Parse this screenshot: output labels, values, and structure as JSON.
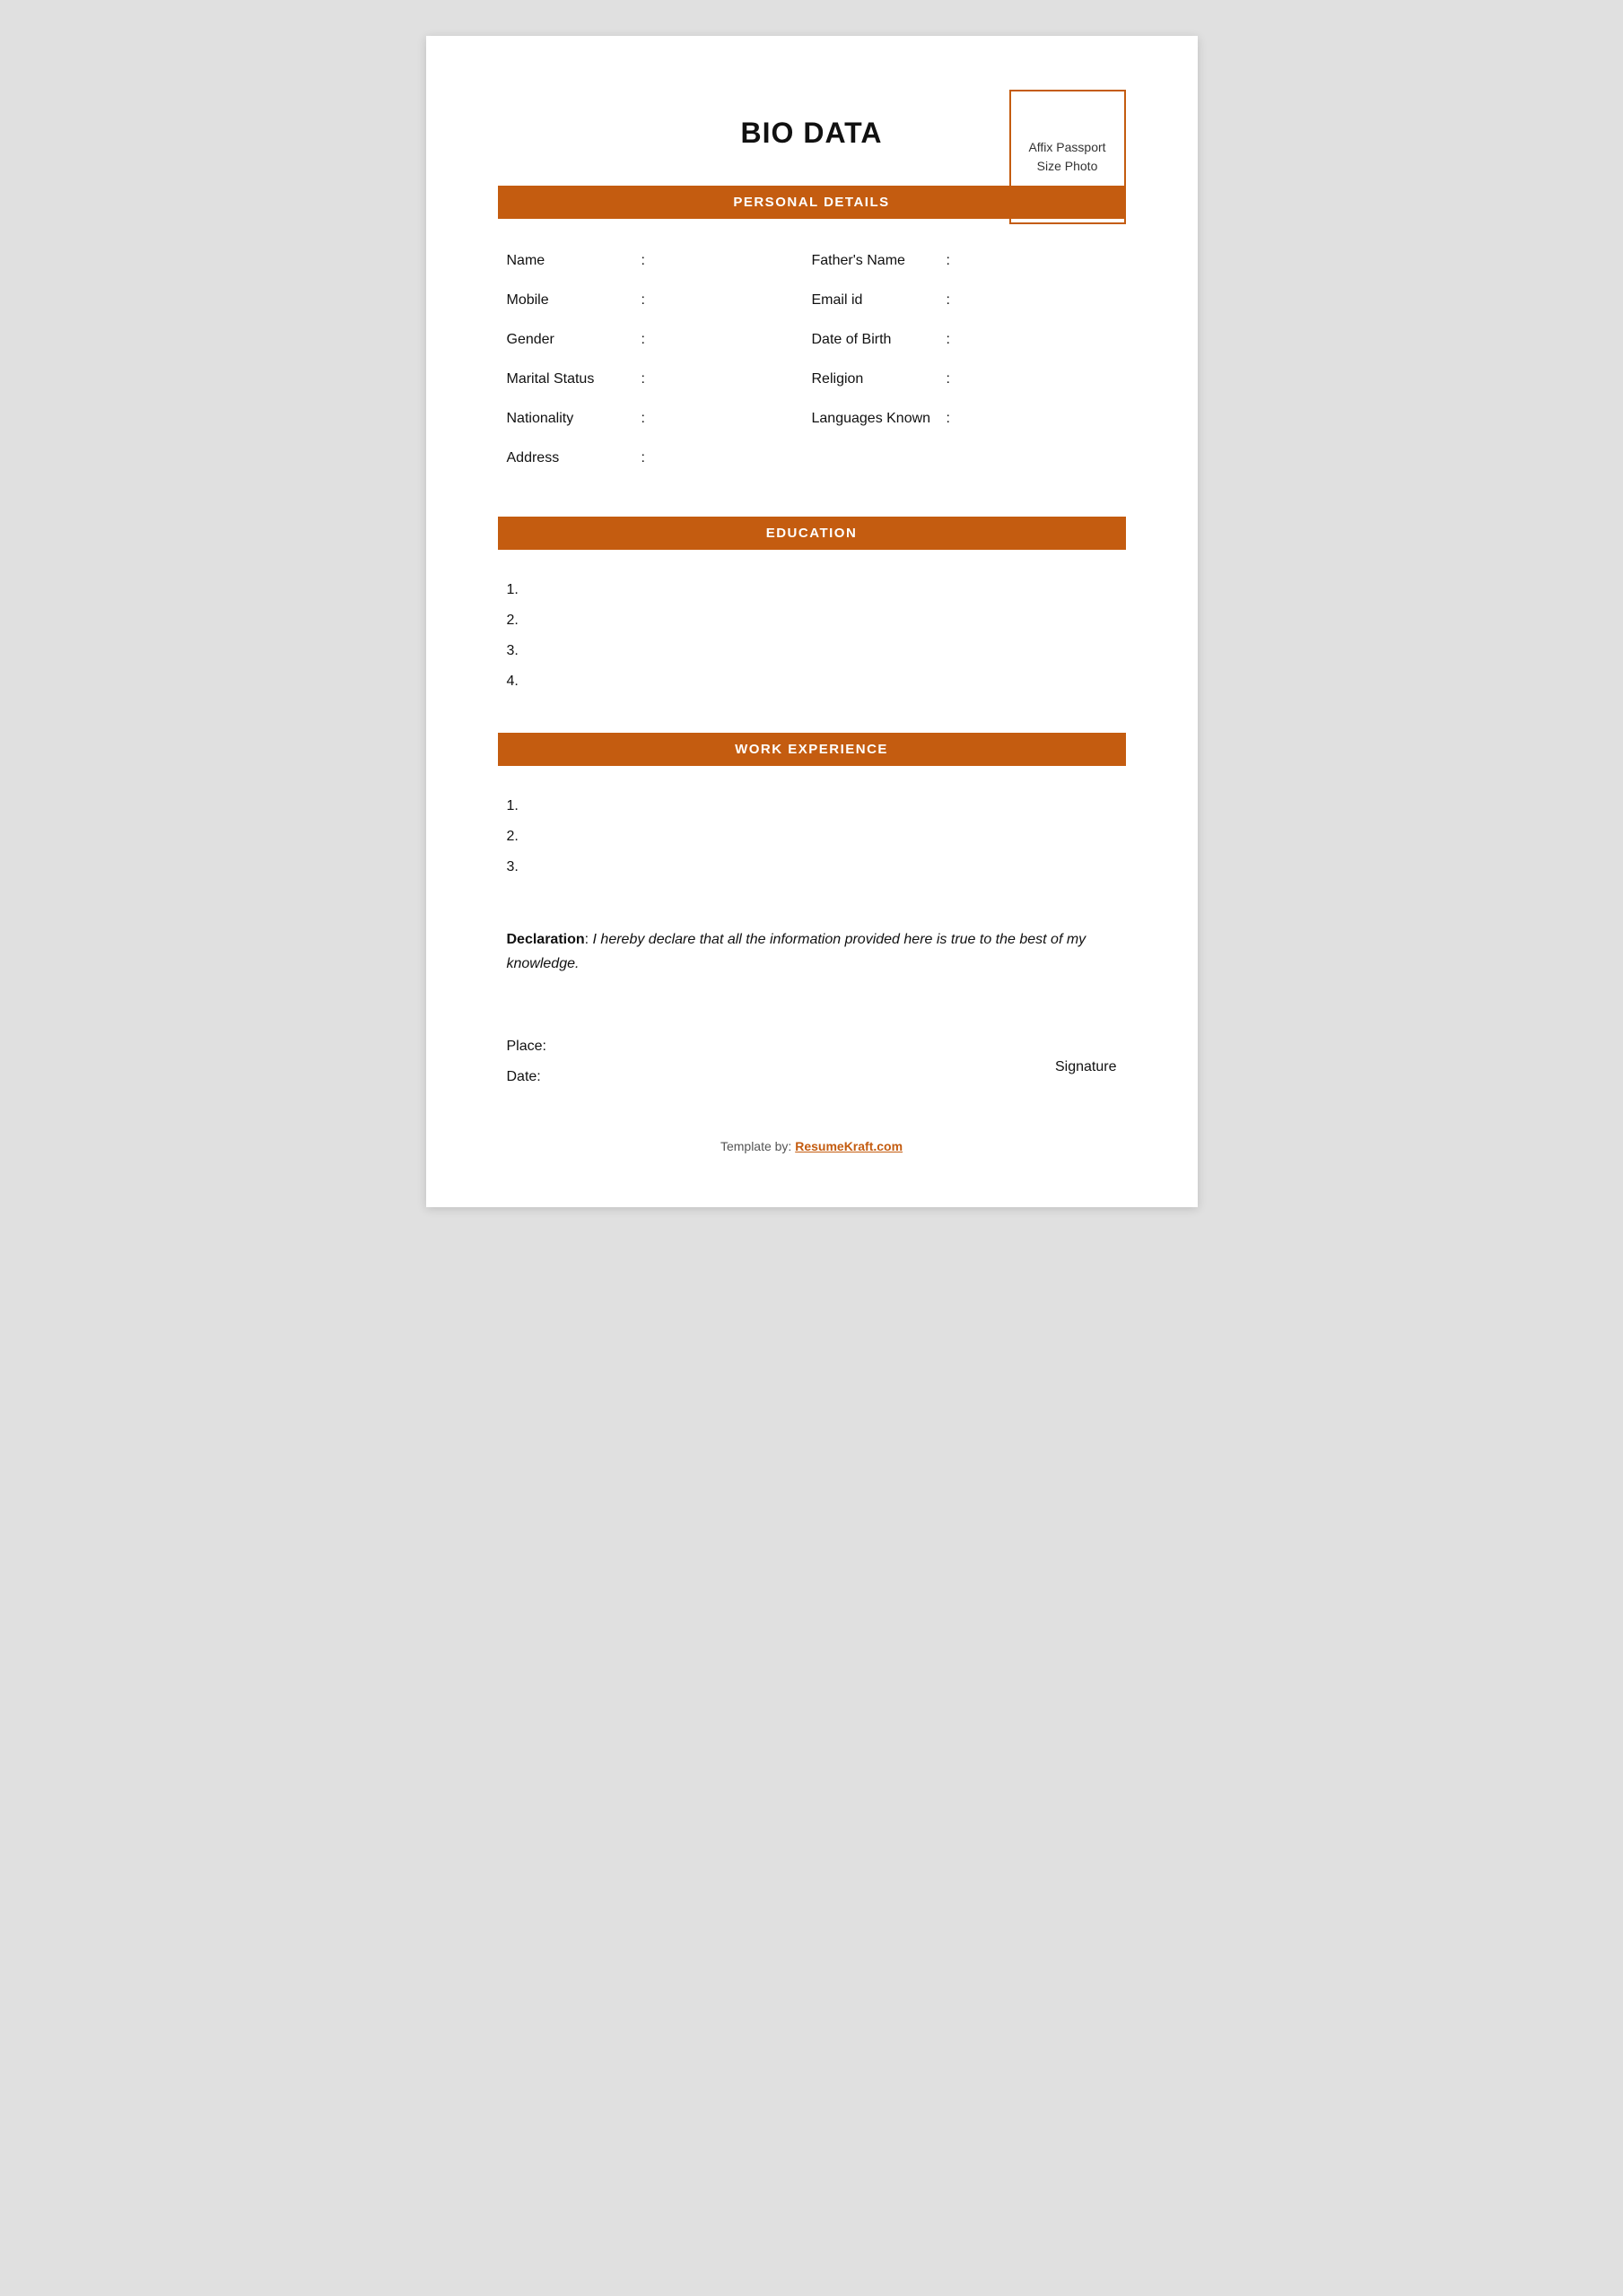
{
  "page": {
    "title": "BIO DATA",
    "photo_box_text": "Affix Passport Size Photo"
  },
  "personal_details": {
    "section_title": "PERSONAL DETAILS",
    "fields_left": [
      {
        "label": "Name",
        "colon": ":"
      },
      {
        "label": "Mobile",
        "colon": ":"
      },
      {
        "label": "Gender",
        "colon": ":"
      },
      {
        "label": "Marital Status",
        "colon": ":"
      },
      {
        "label": "Nationality",
        "colon": ":"
      },
      {
        "label": "Address",
        "colon": ":"
      }
    ],
    "fields_right": [
      {
        "label": "Father's Name",
        "colon": ":"
      },
      {
        "label": "Email id",
        "colon": ":"
      },
      {
        "label": "Date of Birth",
        "colon": ":"
      },
      {
        "label": "Religion",
        "colon": ":"
      },
      {
        "label": "Languages Known",
        "colon": ":"
      }
    ]
  },
  "education": {
    "section_title": "EDUCATION",
    "items": [
      "1.",
      "2.",
      "3.",
      "4."
    ]
  },
  "work_experience": {
    "section_title": "WORK EXPERIENCE",
    "items": [
      "1.",
      "2.",
      "3."
    ]
  },
  "declaration": {
    "label": "Declaration",
    "colon": ":",
    "text": "I hereby declare that all the information provided here is true to the best of my knowledge."
  },
  "footer_fields": {
    "place_label": "Place:",
    "date_label": "Date:",
    "signature_label": "Signature"
  },
  "template_footer": {
    "prefix": "Template by: ",
    "link_text": "ResumeKraft.com",
    "link_url": "#"
  },
  "colors": {
    "accent": "#c45c10",
    "text": "#111111",
    "white": "#ffffff"
  }
}
